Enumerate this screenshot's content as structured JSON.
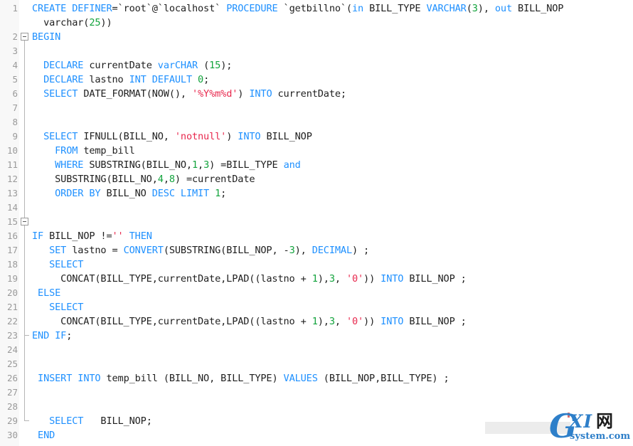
{
  "editor": {
    "language": "SQL",
    "total_lines": 30,
    "gutter_bg": "#f8f8f8",
    "code_bg": "#ffffff",
    "colors": {
      "keyword": "#1e90ff",
      "number": "#12a33c",
      "string": "#e8294e",
      "plain": "#202020",
      "line_number": "#9a9a9a",
      "fold_guide": "#b5b5b5"
    },
    "lines": [
      {
        "number": "1",
        "tokens": [
          {
            "t": "CREATE DEFINER",
            "c": "kw"
          },
          {
            "t": "=`",
            "c": "pl"
          },
          {
            "t": "root",
            "c": "pl"
          },
          {
            "t": "`@`",
            "c": "pl"
          },
          {
            "t": "localhost",
            "c": "pl"
          },
          {
            "t": "` ",
            "c": "pl"
          },
          {
            "t": "PROCEDURE",
            "c": "kw"
          },
          {
            "t": " `getbillno`(",
            "c": "pl"
          },
          {
            "t": "in",
            "c": "kw"
          },
          {
            "t": " BILL_TYPE ",
            "c": "pl"
          },
          {
            "t": "VARCHAR",
            "c": "kw"
          },
          {
            "t": "(",
            "c": "pl"
          },
          {
            "t": "3",
            "c": "num"
          },
          {
            "t": "), ",
            "c": "pl"
          },
          {
            "t": "out",
            "c": "kw"
          },
          {
            "t": " BILL_NOP",
            "c": "pl"
          }
        ]
      },
      {
        "number": "",
        "tokens": [
          {
            "t": "  varchar(",
            "c": "pl"
          },
          {
            "t": "25",
            "c": "num"
          },
          {
            "t": "))",
            "c": "pl"
          }
        ]
      },
      {
        "number": "2",
        "tokens": [
          {
            "t": "BEGIN",
            "c": "kw"
          }
        ]
      },
      {
        "number": "3",
        "tokens": []
      },
      {
        "number": "4",
        "tokens": [
          {
            "t": "  ",
            "c": "pl"
          },
          {
            "t": "DECLARE",
            "c": "kw"
          },
          {
            "t": " currentDate ",
            "c": "pl"
          },
          {
            "t": "varCHAR",
            "c": "kw"
          },
          {
            "t": " (",
            "c": "pl"
          },
          {
            "t": "15",
            "c": "num"
          },
          {
            "t": ");",
            "c": "pl"
          }
        ]
      },
      {
        "number": "5",
        "tokens": [
          {
            "t": "  ",
            "c": "pl"
          },
          {
            "t": "DECLARE",
            "c": "kw"
          },
          {
            "t": " lastno ",
            "c": "pl"
          },
          {
            "t": "INT DEFAULT",
            "c": "kw"
          },
          {
            "t": " ",
            "c": "pl"
          },
          {
            "t": "0",
            "c": "num"
          },
          {
            "t": ";",
            "c": "pl"
          }
        ]
      },
      {
        "number": "6",
        "tokens": [
          {
            "t": "  ",
            "c": "pl"
          },
          {
            "t": "SELECT",
            "c": "kw"
          },
          {
            "t": " DATE_FORMAT(NOW(), ",
            "c": "pl"
          },
          {
            "t": "'%Y%m%d'",
            "c": "str"
          },
          {
            "t": ") ",
            "c": "pl"
          },
          {
            "t": "INTO",
            "c": "kw"
          },
          {
            "t": " currentDate;",
            "c": "pl"
          }
        ]
      },
      {
        "number": "7",
        "tokens": []
      },
      {
        "number": "8",
        "tokens": []
      },
      {
        "number": "9",
        "tokens": [
          {
            "t": "  ",
            "c": "pl"
          },
          {
            "t": "SELECT",
            "c": "kw"
          },
          {
            "t": " IFNULL(BILL_NO, ",
            "c": "pl"
          },
          {
            "t": "'notnull'",
            "c": "str"
          },
          {
            "t": ") ",
            "c": "pl"
          },
          {
            "t": "INTO",
            "c": "kw"
          },
          {
            "t": " BILL_NOP",
            "c": "pl"
          }
        ]
      },
      {
        "number": "10",
        "tokens": [
          {
            "t": "    ",
            "c": "pl"
          },
          {
            "t": "FROM",
            "c": "kw"
          },
          {
            "t": " temp_bill",
            "c": "pl"
          }
        ]
      },
      {
        "number": "11",
        "tokens": [
          {
            "t": "    ",
            "c": "pl"
          },
          {
            "t": "WHERE",
            "c": "kw"
          },
          {
            "t": " SUBSTRING(BILL_NO,",
            "c": "pl"
          },
          {
            "t": "1",
            "c": "num"
          },
          {
            "t": ",",
            "c": "pl"
          },
          {
            "t": "3",
            "c": "num"
          },
          {
            "t": ") =BILL_TYPE ",
            "c": "pl"
          },
          {
            "t": "and",
            "c": "kw"
          }
        ]
      },
      {
        "number": "12",
        "tokens": [
          {
            "t": "    SUBSTRING(BILL_NO,",
            "c": "pl"
          },
          {
            "t": "4",
            "c": "num"
          },
          {
            "t": ",",
            "c": "pl"
          },
          {
            "t": "8",
            "c": "num"
          },
          {
            "t": ") =currentDate",
            "c": "pl"
          }
        ]
      },
      {
        "number": "13",
        "tokens": [
          {
            "t": "    ",
            "c": "pl"
          },
          {
            "t": "ORDER BY",
            "c": "kw"
          },
          {
            "t": " BILL_NO ",
            "c": "pl"
          },
          {
            "t": "DESC LIMIT",
            "c": "kw"
          },
          {
            "t": " ",
            "c": "pl"
          },
          {
            "t": "1",
            "c": "num"
          },
          {
            "t": ";",
            "c": "pl"
          }
        ]
      },
      {
        "number": "14",
        "tokens": []
      },
      {
        "number": "15",
        "tokens": []
      },
      {
        "number": "16",
        "tokens": [
          {
            "t": "IF",
            "c": "kw"
          },
          {
            "t": " BILL_NOP !=",
            "c": "pl"
          },
          {
            "t": "''",
            "c": "str"
          },
          {
            "t": " ",
            "c": "pl"
          },
          {
            "t": "THEN",
            "c": "kw"
          }
        ]
      },
      {
        "number": "17",
        "tokens": [
          {
            "t": "   ",
            "c": "pl"
          },
          {
            "t": "SET",
            "c": "kw"
          },
          {
            "t": " lastno = ",
            "c": "pl"
          },
          {
            "t": "CONVERT",
            "c": "kw"
          },
          {
            "t": "(SUBSTRING(BILL_NOP, -",
            "c": "pl"
          },
          {
            "t": "3",
            "c": "num"
          },
          {
            "t": "), ",
            "c": "pl"
          },
          {
            "t": "DECIMAL",
            "c": "kw"
          },
          {
            "t": ") ;",
            "c": "pl"
          }
        ]
      },
      {
        "number": "18",
        "tokens": [
          {
            "t": "   ",
            "c": "pl"
          },
          {
            "t": "SELECT",
            "c": "kw"
          }
        ]
      },
      {
        "number": "19",
        "tokens": [
          {
            "t": "     CONCAT(BILL_TYPE,currentDate,LPAD((lastno + ",
            "c": "pl"
          },
          {
            "t": "1",
            "c": "num"
          },
          {
            "t": "),",
            "c": "pl"
          },
          {
            "t": "3",
            "c": "num"
          },
          {
            "t": ", ",
            "c": "pl"
          },
          {
            "t": "'0'",
            "c": "str"
          },
          {
            "t": ")) ",
            "c": "pl"
          },
          {
            "t": "INTO",
            "c": "kw"
          },
          {
            "t": " BILL_NOP ;",
            "c": "pl"
          }
        ]
      },
      {
        "number": "20",
        "tokens": [
          {
            "t": " ",
            "c": "pl"
          },
          {
            "t": "ELSE",
            "c": "kw"
          }
        ]
      },
      {
        "number": "21",
        "tokens": [
          {
            "t": "   ",
            "c": "pl"
          },
          {
            "t": "SELECT",
            "c": "kw"
          }
        ]
      },
      {
        "number": "22",
        "tokens": [
          {
            "t": "     CONCAT(BILL_TYPE,currentDate,LPAD((lastno + ",
            "c": "pl"
          },
          {
            "t": "1",
            "c": "num"
          },
          {
            "t": "),",
            "c": "pl"
          },
          {
            "t": "3",
            "c": "num"
          },
          {
            "t": ", ",
            "c": "pl"
          },
          {
            "t": "'0'",
            "c": "str"
          },
          {
            "t": ")) ",
            "c": "pl"
          },
          {
            "t": "INTO",
            "c": "kw"
          },
          {
            "t": " BILL_NOP ;",
            "c": "pl"
          }
        ]
      },
      {
        "number": "23",
        "tokens": [
          {
            "t": "END IF",
            "c": "kw"
          },
          {
            "t": ";",
            "c": "pl"
          }
        ]
      },
      {
        "number": "24",
        "tokens": []
      },
      {
        "number": "25",
        "tokens": []
      },
      {
        "number": "26",
        "tokens": [
          {
            "t": " ",
            "c": "pl"
          },
          {
            "t": "INSERT INTO",
            "c": "kw"
          },
          {
            "t": " temp_bill (BILL_NO, BILL_TYPE) ",
            "c": "pl"
          },
          {
            "t": "VALUES",
            "c": "kw"
          },
          {
            "t": " (BILL_NOP,BILL_TYPE) ;",
            "c": "pl"
          }
        ]
      },
      {
        "number": "27",
        "tokens": []
      },
      {
        "number": "28",
        "tokens": []
      },
      {
        "number": "29",
        "tokens": [
          {
            "t": "   ",
            "c": "pl"
          },
          {
            "t": "SELECT",
            "c": "kw"
          },
          {
            "t": "   BILL_NOP;",
            "c": "pl"
          }
        ]
      },
      {
        "number": "30",
        "tokens": [
          {
            "t": " ",
            "c": "pl"
          },
          {
            "t": "END",
            "c": "kw"
          }
        ]
      }
    ],
    "fold_markers": [
      {
        "name": "fold-marker-begin",
        "line_index": 2,
        "state": "expanded"
      },
      {
        "name": "fold-marker-if",
        "line_index": 15,
        "state": "expanded"
      }
    ]
  },
  "watermark": {
    "letter": "G",
    "mid": "XI",
    "cjk": "网",
    "sub": "system.com",
    "color": "#2e7fc9"
  }
}
